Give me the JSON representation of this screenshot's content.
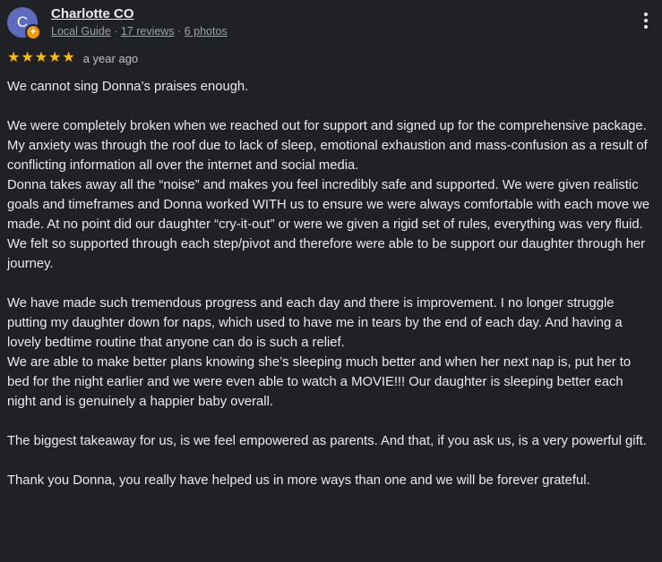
{
  "reviewer": {
    "avatar_letter": "C",
    "name": "Charlotte CO",
    "guide_label": "Local Guide",
    "sep1": " · ",
    "reviews": "17 reviews",
    "sep2": " · ",
    "photos": "6 photos"
  },
  "rating": {
    "stars": 5,
    "time": "a year ago"
  },
  "review": {
    "paragraphs": [
      "We cannot sing Donna’s praises enough.",
      "We were completely broken when we reached out for support and signed up for the comprehensive package.",
      "My anxiety was through the roof due to lack of sleep, emotional exhaustion and mass-confusion as a result of conflicting information all over the internet and social media.",
      "Donna takes away all the “noise” and makes you feel incredibly safe and supported. We were given realistic goals and timeframes and Donna worked WITH us to ensure we were always comfortable with each move we made. At no point did our daughter “cry-it-out” or were we given a rigid set of rules, everything was very fluid.",
      "We felt so supported through each step/pivot and therefore were able to be support our daughter through her journey.",
      "We have made such tremendous progress and each day and there is improvement. I no longer struggle putting my daughter down for naps, which used to have me in tears by the end of each day. And having a lovely bedtime routine that anyone can do is such a relief.",
      "We are able to make better plans knowing she’s sleeping much better and when her next nap is, put her to bed for the night earlier and we were even able to watch a MOVIE!!! Our daughter is sleeping better each night and is genuinely a happier baby overall.",
      "The biggest takeaway for us, is we feel empowered as parents. And that, if you ask us, is a very powerful gift.",
      "Thank you Donna, you really have helped us in more ways than one and we will be forever grateful."
    ]
  },
  "colors": {
    "background": "#202124",
    "star": "#fbbc04",
    "avatar": "#5c6bc0",
    "badge": "#f29900"
  },
  "icons": {
    "menu": "more-vert-icon",
    "badge": "local-guide-badge-icon",
    "star": "star-icon"
  }
}
